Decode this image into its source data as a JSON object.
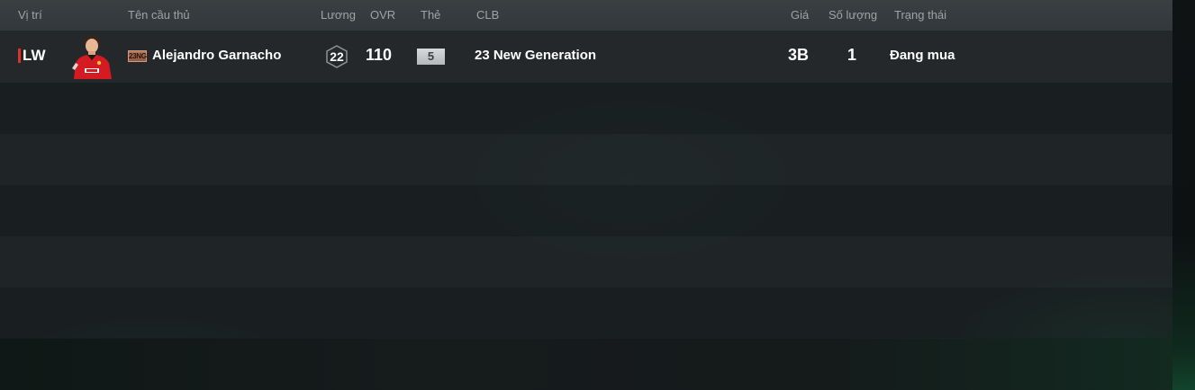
{
  "table": {
    "headers": {
      "position": "Vị trí",
      "player_name": "Tên cầu thủ",
      "wage": "Lương",
      "ovr": "OVR",
      "grade": "Thẻ",
      "club": "CLB",
      "price": "Giá",
      "quantity": "Số lượng",
      "status": "Trạng thái"
    },
    "rows": [
      {
        "position": "LW",
        "position_color": "#e0302a",
        "avatar_icon": "player-portrait-icon",
        "season_badge": "23NG",
        "season_badge_color": "#a46b50",
        "player_name": "Alejandro Garnacho",
        "wage": "22",
        "ovr": "110",
        "grade": "5",
        "club": "23 New Generation",
        "price": "3B",
        "quantity": "1",
        "status": "Đang mua"
      }
    ]
  }
}
